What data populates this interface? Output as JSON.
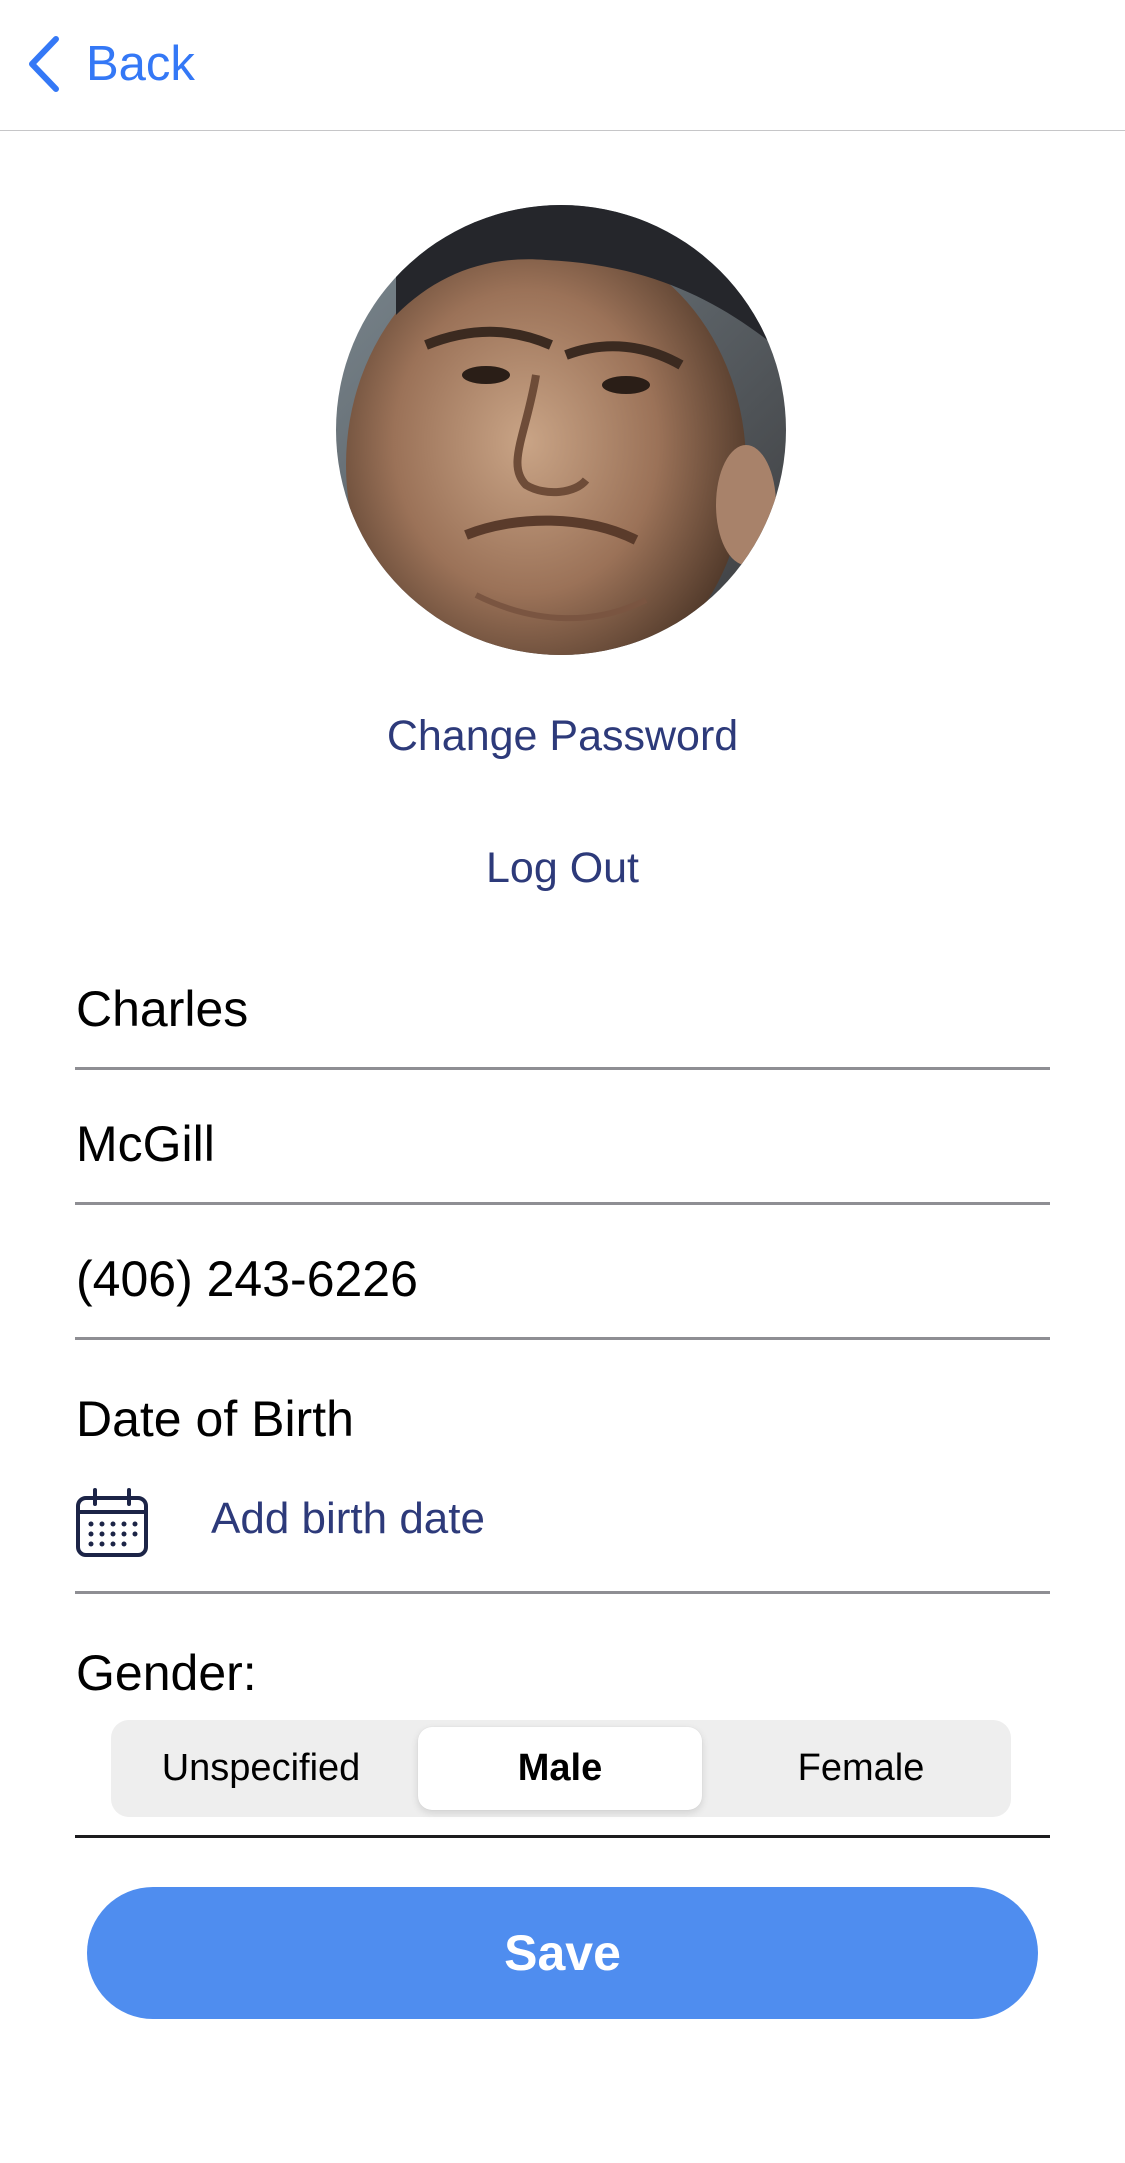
{
  "nav": {
    "back_label": "Back"
  },
  "profile": {
    "avatar_icon": "user-photo",
    "change_password_label": "Change Password",
    "logout_label": "Log Out"
  },
  "form": {
    "first_name": "Charles",
    "last_name": "McGill",
    "phone": "(406) 243-6226",
    "dob_label": "Date of Birth",
    "dob_action": "Add birth date",
    "gender_label": "Gender:",
    "gender_options": [
      "Unspecified",
      "Male",
      "Female"
    ],
    "gender_selected": "Male",
    "save_label": "Save"
  },
  "colors": {
    "accent_blue": "#3478f6",
    "link_navy": "#2d3a7a",
    "save_button": "#4f8def"
  }
}
